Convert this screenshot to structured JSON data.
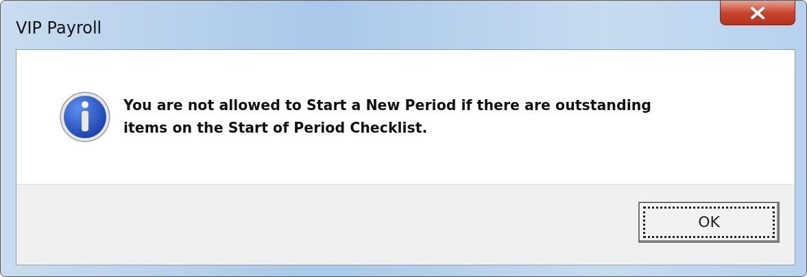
{
  "window": {
    "title": "VIP Payroll"
  },
  "message": {
    "kind": "information",
    "text": "You are not allowed to Start a New Period if there are outstanding items on the Start of Period Checklist."
  },
  "buttons": [
    {
      "label": "OK",
      "focused": true
    }
  ]
}
